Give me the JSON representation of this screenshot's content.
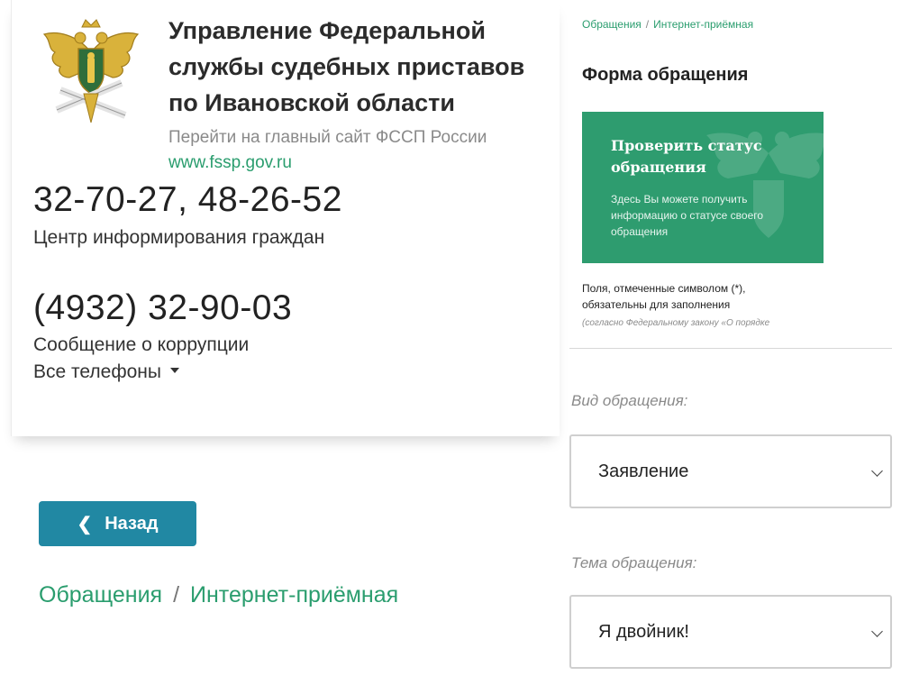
{
  "header": {
    "org_title_line1": "Управление Федеральной",
    "org_title_line2": "службы судебных приставов",
    "org_title_line3": "по Ивановской области",
    "main_site_link": "Перейти на главный сайт ФССП России",
    "main_site_url": "www.fssp.gov.ru"
  },
  "contacts": {
    "phone_1": "32-70-27, 48-26-52",
    "phone_1_caption": "Центр информирования граждан",
    "phone_2": "(4932) 32-90-03",
    "phone_2_caption": "Сообщение о коррупции",
    "all_phones_label": "Все телефоны"
  },
  "navigation": {
    "back_label": "Назад",
    "breadcrumb": [
      "Обращения",
      "Интернет-приёмная"
    ],
    "breadcrumb_separator": "/"
  },
  "form": {
    "breadcrumb": [
      "Обращения",
      "Интернет-приёмная"
    ],
    "breadcrumb_separator": "/",
    "title": "Форма обращения",
    "status_card": {
      "title": "Проверить статус обращения",
      "description": "Здесь Вы можете получить информацию о статусе своего обращения"
    },
    "required_note_line1": "Поля, отмеченные символом (*),",
    "required_note_line2": "обязательны для заполнения",
    "law_note": "(согласно Федеральному закону «О порядке",
    "fields": [
      {
        "label": "Вид обращения:",
        "value": "Заявление"
      },
      {
        "label": "Тема обращения:",
        "value": "Я двойник!"
      }
    ]
  },
  "colors": {
    "accent_green": "#2a9d6e",
    "status_card_bg": "#2e9c6f",
    "back_button_bg": "#2188a3"
  },
  "icons": {
    "emblem": "fssp-eagle-emblem",
    "all_phones_caret": "caret-down-icon",
    "back_chevron": "chevron-left-icon",
    "select_chevron": "chevron-down-icon"
  }
}
